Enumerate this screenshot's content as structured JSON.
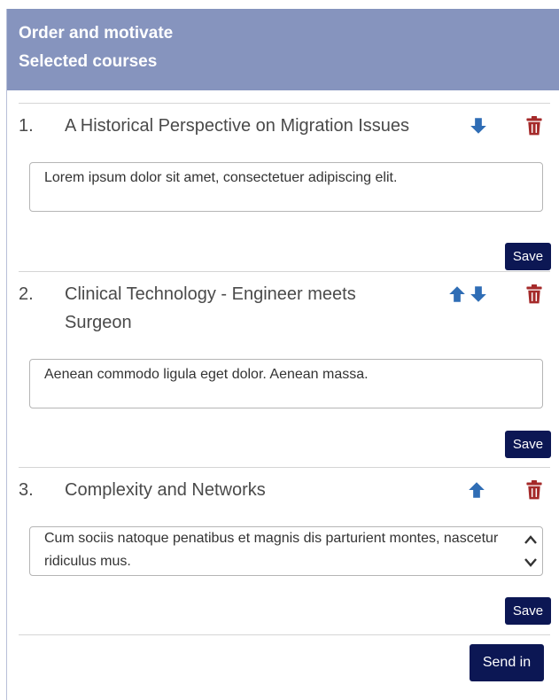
{
  "header": {
    "line1": "Order and motivate",
    "line2": "Selected courses"
  },
  "courses": [
    {
      "number": "1.",
      "title": "A Historical Perspective on Migration Issues",
      "note": "Lorem ipsum dolor sit amet, consectetuer adipiscing elit.",
      "save_label": "Save",
      "can_move_up": false,
      "can_move_down": true
    },
    {
      "number": "2.",
      "title": "Clinical Technology - Engineer meets Surgeon",
      "note": "Aenean commodo ligula eget dolor. Aenean massa.",
      "save_label": "Save",
      "can_move_up": true,
      "can_move_down": true
    },
    {
      "number": "3.",
      "title": "Complexity and Networks",
      "note": "Cum sociis natoque penatibus et magnis dis parturient montes, nascetur ridiculus mus.",
      "save_label": "Save",
      "can_move_up": true,
      "can_move_down": false
    }
  ],
  "send_label": "Send in",
  "colors": {
    "header_bg": "#8694be",
    "arrow": "#2f6db5",
    "trash": "#a52a2a",
    "button_bg": "#0c1754"
  },
  "icons": {
    "up": "arrow-up-icon",
    "down": "arrow-down-icon",
    "delete": "trash-icon"
  }
}
